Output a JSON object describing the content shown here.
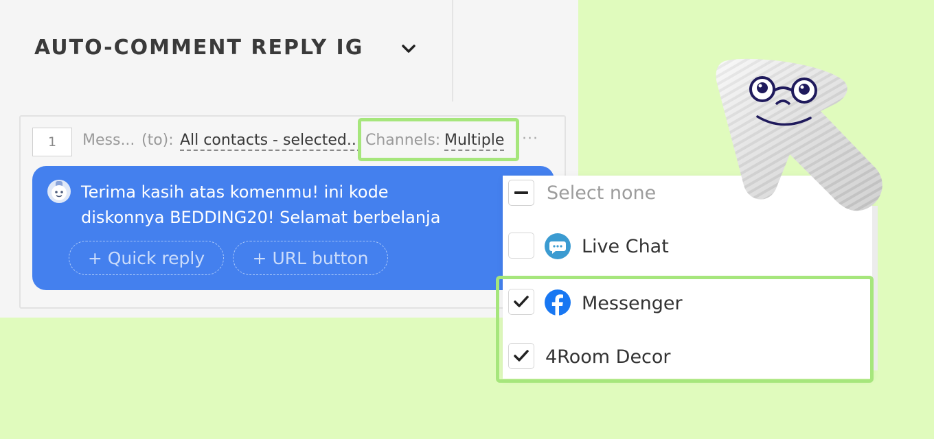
{
  "flow": {
    "title": "AUTO-COMMENT REPLY IG"
  },
  "step": {
    "number": "1",
    "messages_label": "Mess...",
    "to_label": "(to):",
    "contacts_value": "All contacts - selected...",
    "channels_label": "Channels:",
    "channels_value": "Multiple",
    "more": "···"
  },
  "message": {
    "line1": "Terima kasih atas komenmu! ini kode",
    "line2": "diskonnya BEDDING20! Selamat berbelanja",
    "quick_reply": "+ Quick reply",
    "url_button": "+ URL button"
  },
  "channels_dropdown": {
    "select_none": "Select none",
    "options": [
      {
        "label": "Live Chat",
        "checked": false,
        "icon": "live-chat-icon"
      },
      {
        "label": "Messenger",
        "checked": true,
        "icon": "facebook-icon"
      },
      {
        "label": "4Room Decor",
        "checked": true,
        "icon": "none"
      }
    ]
  },
  "colors": {
    "background": "#e0fbbd",
    "highlight": "#a6e67c",
    "bubble": "#4480ee",
    "facebook": "#1877f2",
    "live_chat": "#3b9bd1"
  }
}
